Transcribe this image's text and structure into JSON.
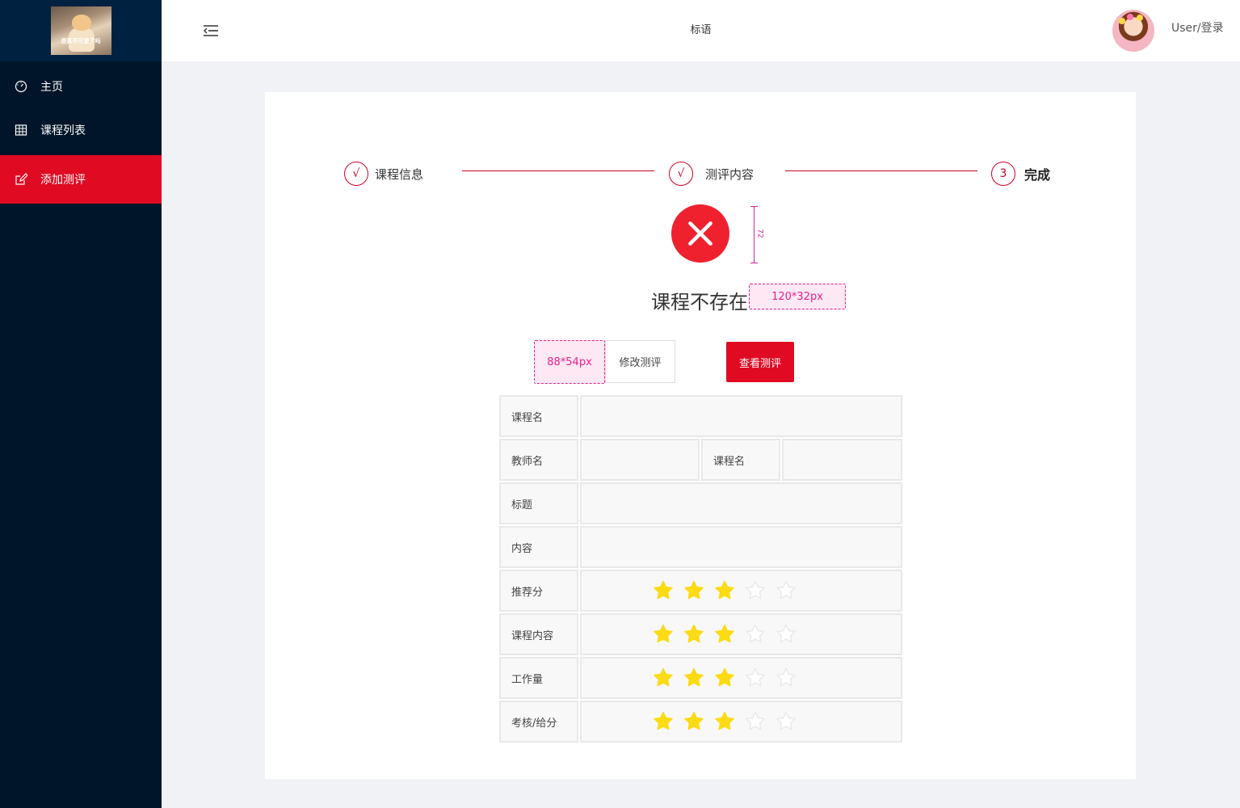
{
  "sidebar": {
    "logo_text": "是真不可爱了吗",
    "items": [
      {
        "label": "主页",
        "icon": "dashboard-icon"
      },
      {
        "label": "课程列表",
        "icon": "table-icon"
      },
      {
        "label": "添加测评",
        "icon": "edit-icon",
        "active": true
      }
    ]
  },
  "header": {
    "title": "标语",
    "user_login": "User/登录"
  },
  "steps": [
    {
      "marker": "√",
      "label": "课程信息"
    },
    {
      "marker": "√",
      "label": "测评内容"
    },
    {
      "marker": "3",
      "label": "完成"
    }
  ],
  "result": {
    "message": "课程不存在",
    "annot_height": "72",
    "annot_text_size": "120*32px",
    "annot_button_gap": "88*54px"
  },
  "actions": {
    "edit_label": "修改测评",
    "view_label": "查看测评"
  },
  "form": {
    "course_name_label": "课程名",
    "teacher_name_label": "教师名",
    "course_name_label_2": "课程名",
    "title_label": "标题",
    "content_label": "内容",
    "ratings": [
      {
        "label": "推荐分",
        "value": 3,
        "max": 5
      },
      {
        "label": "课程内容",
        "value": 3,
        "max": 5
      },
      {
        "label": "工作量",
        "value": 3,
        "max": 5
      },
      {
        "label": "考核/给分",
        "value": 3,
        "max": 5
      }
    ]
  },
  "colors": {
    "sidebar_bg": "#001529",
    "accent": "#e00a22",
    "star_on": "#fadb14",
    "star_off": "#e8e8e8"
  }
}
